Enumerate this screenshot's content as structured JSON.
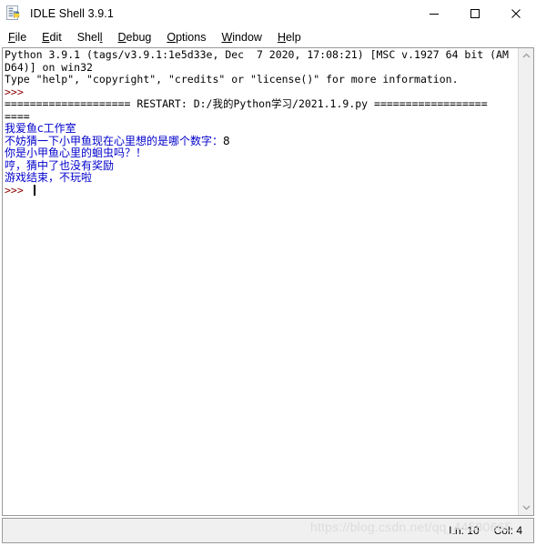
{
  "window": {
    "title": "IDLE Shell 3.9.1",
    "app_icon": "python-idle-icon",
    "controls": [
      {
        "name": "minimize",
        "glyph": "minimize-icon"
      },
      {
        "name": "maximize",
        "glyph": "maximize-icon"
      },
      {
        "name": "close",
        "glyph": "close-icon"
      }
    ]
  },
  "menubar": {
    "items": [
      {
        "label": "File",
        "accel_index": 0
      },
      {
        "label": "Edit",
        "accel_index": 0
      },
      {
        "label": "Shell",
        "accel_index": 4
      },
      {
        "label": "Debug",
        "accel_index": 0
      },
      {
        "label": "Options",
        "accel_index": 0
      },
      {
        "label": "Window",
        "accel_index": 0
      },
      {
        "label": "Help",
        "accel_index": 0
      }
    ]
  },
  "console": {
    "lines": [
      {
        "id": "banner-1",
        "text": "Python 3.9.1 (tags/v3.9.1:1e5d33e, Dec  7 2020, 17:08:21) [MSC v.1927 64 bit (AM",
        "color": "black",
        "mono": true
      },
      {
        "id": "banner-2",
        "text": "D64)] on win32",
        "color": "black",
        "mono": true
      },
      {
        "id": "banner-3",
        "text": "Type \"help\", \"copyright\", \"credits\" or \"license()\" for more information.",
        "color": "black",
        "mono": true
      },
      {
        "id": "prompt-1",
        "text": ">>> ",
        "color": "maroon",
        "mono": true
      },
      {
        "id": "restart-1",
        "text": "==================== RESTART: D:/我的Python学习/2021.1.9.py ==================",
        "color": "black",
        "mono": true
      },
      {
        "id": "restart-2",
        "text": "====",
        "color": "black",
        "mono": true
      },
      {
        "id": "out-1",
        "text": "我爱鱼c工作室",
        "color": "blue",
        "mono": false
      },
      {
        "id": "out-2",
        "text": "不妨猜一下小甲鱼现在心里想的是哪个数字：",
        "color": "blue",
        "mono": false,
        "input_echo": "8"
      },
      {
        "id": "out-3",
        "text": "你是小甲鱼心里的蛔虫吗？！",
        "color": "blue",
        "mono": false
      },
      {
        "id": "out-4",
        "text": "哼，猜中了也没有奖励",
        "color": "blue",
        "mono": false
      },
      {
        "id": "out-5",
        "text": "游戏结束，不玩啦",
        "color": "blue",
        "mono": false
      },
      {
        "id": "prompt-2",
        "text": ">>> ",
        "color": "maroon",
        "mono": true,
        "cursor": true
      }
    ]
  },
  "scrollbar": {
    "up_arrow": "chevron-up-icon",
    "down_arrow": "chevron-down-icon"
  },
  "statusbar": {
    "line_label": "Ln: 10",
    "col_label": "Col: 4",
    "watermark": "https://blog.csdn.net/qq_44580665"
  },
  "colors": {
    "output_blue": "#0000cc",
    "prompt_maroon": "#8b0000",
    "chrome_gray": "#f0f0f0",
    "border_gray": "#9a9a9a"
  }
}
